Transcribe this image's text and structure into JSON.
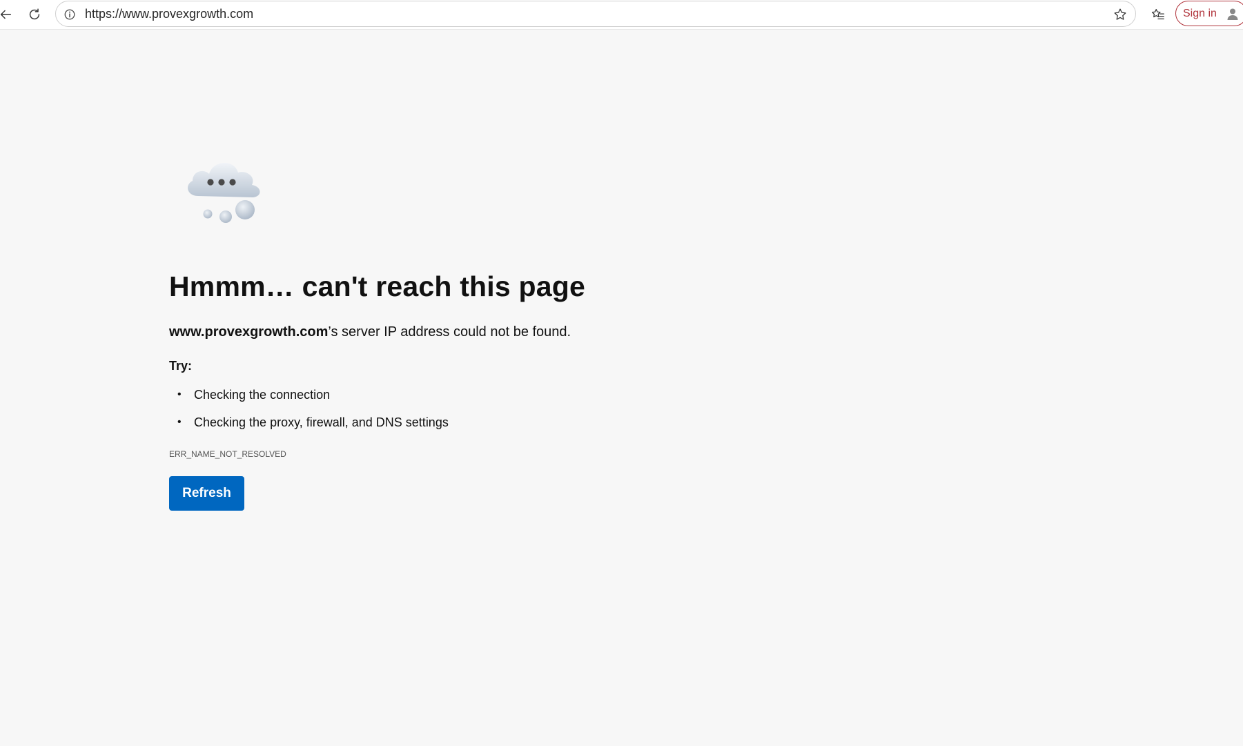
{
  "browser": {
    "url": "https://www.provexgrowth.com",
    "signin_label": "Sign in",
    "accent": "#b0323a"
  },
  "icons": {
    "back": "back-arrow-icon",
    "reload": "reload-icon",
    "site_info": "info-icon",
    "favorite": "star-icon",
    "favorites_list": "favorites-icon",
    "profile": "avatar-icon",
    "hero": "cloud-icon"
  },
  "error": {
    "title": "Hmmm… can't reach this page",
    "host": "www.provexgrowth.com",
    "message_suffix": "’s server IP address could not be found.",
    "try_label": "Try:",
    "suggestions": [
      "Checking the connection",
      "Checking the proxy, firewall, and DNS settings"
    ],
    "code": "ERR_NAME_NOT_RESOLVED",
    "refresh_label": "Refresh",
    "button_color": "#0067c0"
  }
}
